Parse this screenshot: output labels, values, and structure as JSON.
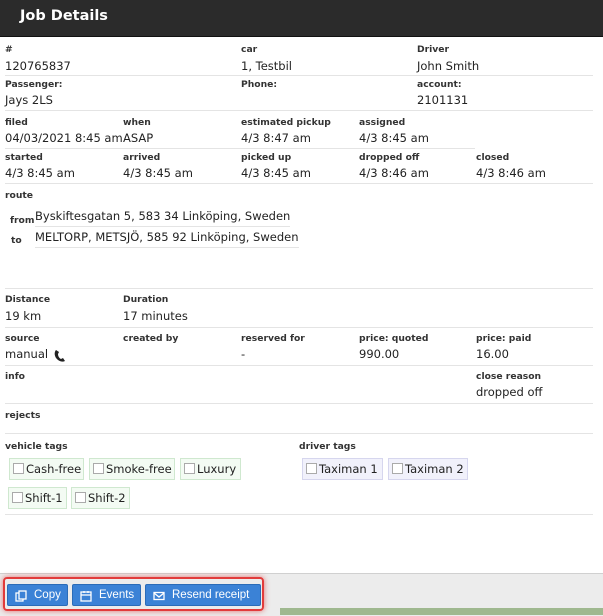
{
  "header": {
    "title": "Job Details"
  },
  "job": {
    "number_label": "#",
    "number": "120765837",
    "car_label": "car",
    "car": "1, Testbil",
    "driver_label": "Driver",
    "driver": "John Smith",
    "passenger_label": "Passenger:",
    "passenger": "Jays 2LS",
    "phone_label": "Phone:",
    "phone": "",
    "account_label": "account:",
    "account": "2101131"
  },
  "times": {
    "filed_label": "filed",
    "filed": "04/03/2021 8:45 am",
    "when_label": "when",
    "when": "ASAP",
    "est_pickup_label": "estimated pickup",
    "est_pickup": "4/3 8:47 am",
    "assigned_label": "assigned",
    "assigned": "4/3 8:45 am",
    "started_label": "started",
    "started": "4/3 8:45 am",
    "arrived_label": "arrived",
    "arrived": "4/3 8:45 am",
    "picked_up_label": "picked up",
    "picked_up": "4/3 8:45 am",
    "dropped_off_label": "dropped off",
    "dropped_off": "4/3 8:46 am",
    "closed_label": "closed",
    "closed": "4/3 8:46 am"
  },
  "route": {
    "label": "route",
    "from_label": "from",
    "from": "Byskiftesgatan 5, 583 34 Linköping, Sweden",
    "to_label": "to",
    "to": "MELTORP, METSJÖ, 585 92 Linköping, Sweden"
  },
  "trip": {
    "distance_label": "Distance",
    "distance": "19 km",
    "duration_label": "Duration",
    "duration": "17 minutes"
  },
  "billing": {
    "source_label": "source",
    "source": "manual",
    "created_by_label": "created by",
    "created_by": "",
    "reserved_for_label": "reserved for",
    "reserved_for": "-",
    "price_quoted_label": "price: quoted",
    "price_quoted": "990.00",
    "price_paid_label": "price: paid",
    "price_paid": "16.00"
  },
  "info": {
    "info_label": "info",
    "info": "",
    "close_reason_label": "close reason",
    "close_reason": "dropped off",
    "rejects_label": "rejects"
  },
  "tags": {
    "vehicle_label": "vehicle tags",
    "vehicle": [
      "Cash-free",
      "Smoke-free",
      "Luxury",
      "Shift-1",
      "Shift-2"
    ],
    "driver_label": "driver tags",
    "driver": [
      "Taximan 1",
      "Taximan 2"
    ]
  },
  "footer": {
    "copy_label": "Copy",
    "events_label": "Events",
    "resend_label": "Resend receipt"
  },
  "colors": {
    "header_bg": "#2b2b2b",
    "button_blue": "#3b82d6",
    "highlight_red": "#e23b3b",
    "vehicle_tag_bg": "#f3fbf3",
    "driver_tag_bg": "#f1f1fb"
  },
  "icons": {
    "copy": "copy-icon",
    "events": "calendar-icon",
    "resend": "envelope-icon",
    "source": "phone-handset-icon"
  }
}
